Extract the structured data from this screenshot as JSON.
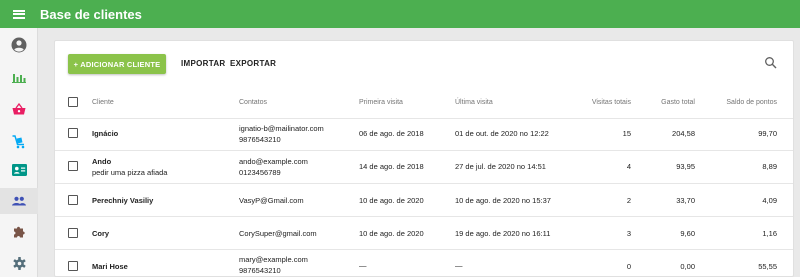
{
  "app": {
    "title": "Base de clientes"
  },
  "toolbar": {
    "add_label": "+ ADICIONAR CLIENTE",
    "import_label": "IMPORTAR",
    "export_label": "EXPORTAR"
  },
  "sidebar": {
    "items": [
      {
        "icon": "account-circle-icon",
        "color": "#616161"
      },
      {
        "icon": "bar-chart-icon",
        "color": "#4caf50"
      },
      {
        "icon": "basket-icon",
        "color": "#e91e63"
      },
      {
        "icon": "cart-icon",
        "color": "#03a9f4"
      },
      {
        "icon": "contact-card-icon",
        "color": "#009688"
      },
      {
        "icon": "people-icon",
        "color": "#3f51b5",
        "active": true
      },
      {
        "icon": "puzzle-icon",
        "color": "#795548"
      },
      {
        "icon": "gear-icon",
        "color": "#546e7a"
      }
    ]
  },
  "table": {
    "headers": {
      "client": "Cliente",
      "contacts": "Contatos",
      "first_visit": "Primeira visita",
      "last_visit": "Última visita",
      "visits_total": "Visitas totais",
      "spent_total": "Gasto total",
      "points_balance": "Saldo de pontos"
    },
    "rows": [
      {
        "name": "Ignácio",
        "note": "",
        "email": "ignatio-b@mailinator.com",
        "phone": "9876543210",
        "first_visit": "06 de ago. de 2018",
        "last_visit": "01 de out. de 2020 no 12:22",
        "visits": "15",
        "spent": "204,58",
        "points": "99,70"
      },
      {
        "name": "Ando",
        "note": "pedir uma pizza afiada",
        "email": "ando@example.com",
        "phone": "0123456789",
        "first_visit": "14 de ago. de 2018",
        "last_visit": "27 de jul. de 2020 no 14:51",
        "visits": "4",
        "spent": "93,95",
        "points": "8,89"
      },
      {
        "name": "Perechniy Vasiliy",
        "note": "",
        "email": "VasyP@Gmail.com",
        "phone": "",
        "first_visit": "10 de ago. de 2020",
        "last_visit": "10 de ago. de 2020 no 15:37",
        "visits": "2",
        "spent": "33,70",
        "points": "4,09"
      },
      {
        "name": "Cory",
        "note": "",
        "email": "CorySuper@gmail.com",
        "phone": "",
        "first_visit": "10 de ago. de 2020",
        "last_visit": "19 de ago. de 2020 no 16:11",
        "visits": "3",
        "spent": "9,60",
        "points": "1,16"
      },
      {
        "name": "Mari Hose",
        "note": "",
        "email": "mary@example.com",
        "phone": "9876543210",
        "first_visit": "—",
        "last_visit": "—",
        "visits": "0",
        "spent": "0,00",
        "points": "55,55"
      }
    ]
  }
}
